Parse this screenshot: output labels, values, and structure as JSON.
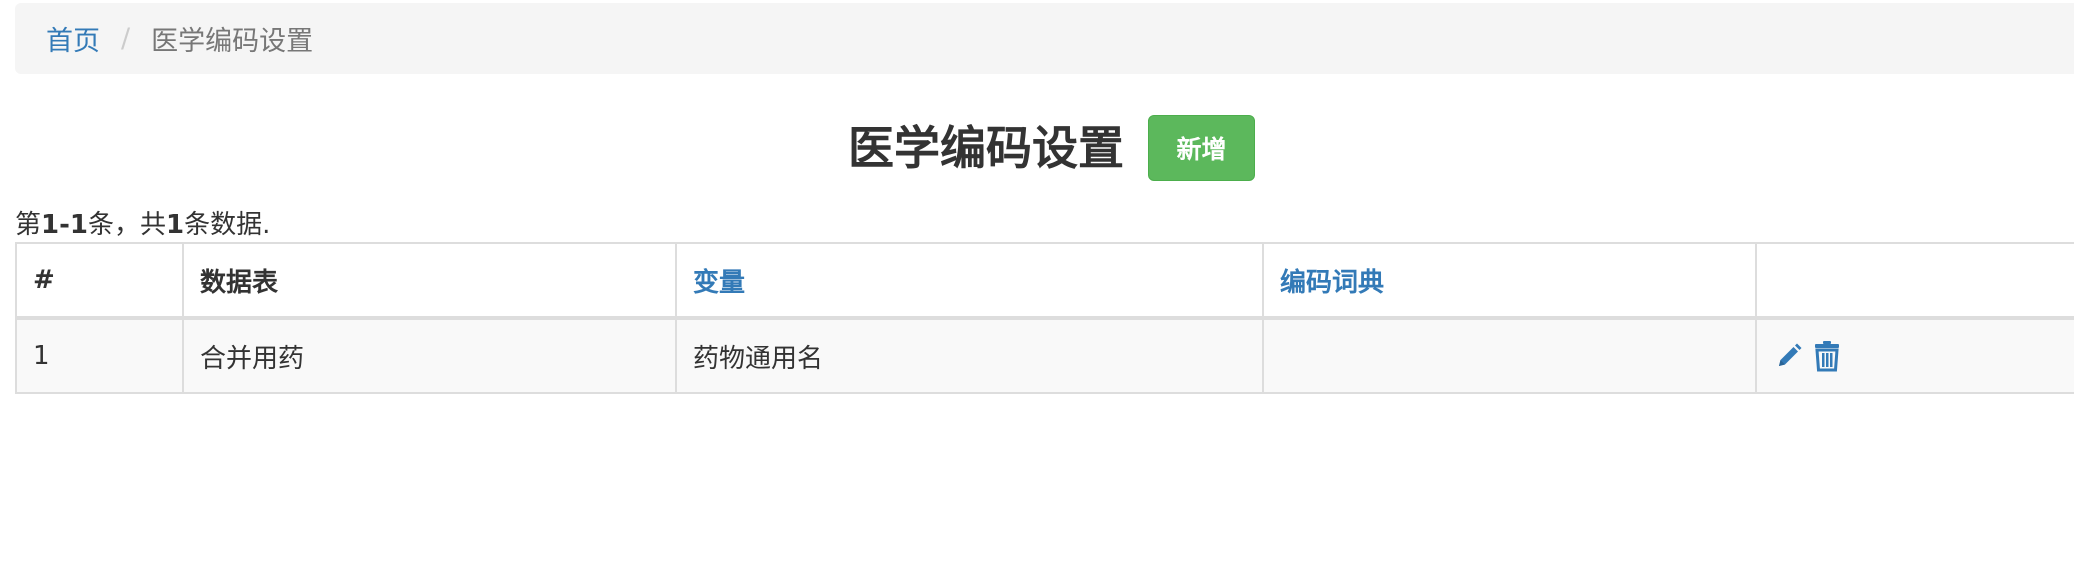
{
  "breadcrumb": {
    "home": "首页",
    "separator": "/",
    "current": "医学编码设置"
  },
  "page": {
    "title": "医学编码设置",
    "add_button": "新增"
  },
  "summary": {
    "prefix": "第",
    "range": "1-1",
    "middle": "条，共",
    "total": "1",
    "suffix": "条数据."
  },
  "table": {
    "headers": {
      "index": "#",
      "data_table": "数据表",
      "variable": "变量",
      "dictionary": "编码词典",
      "actions": ""
    },
    "rows": [
      {
        "index": "1",
        "data_table": "合并用药",
        "variable": "药物通用名",
        "dictionary": ""
      }
    ]
  },
  "icons": {
    "edit": "pencil-icon",
    "delete": "trash-icon"
  },
  "colors": {
    "link": "#337ab7",
    "success": "#5cb85c",
    "breadcrumb_bg": "#f5f5f5",
    "row_bg": "#f9f9f9"
  }
}
